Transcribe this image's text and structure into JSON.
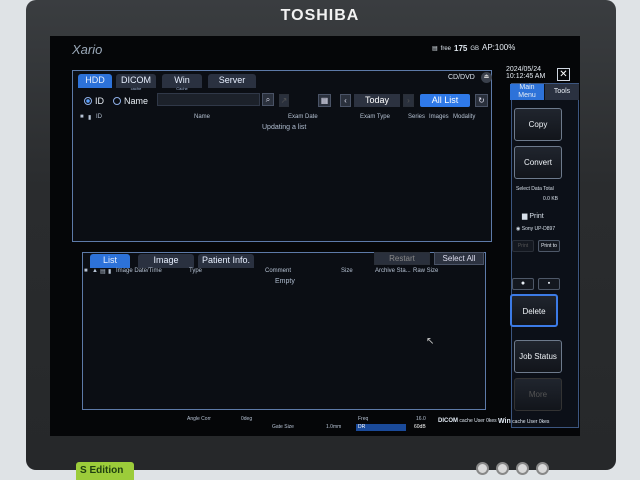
{
  "monitor": {
    "brand": "TOSHIBA",
    "edition": "S Edition"
  },
  "header": {
    "logo": "Xario",
    "free_label": "free",
    "free_value": "175",
    "free_unit": "GB",
    "ap": "AP:100%"
  },
  "upper": {
    "tabs": [
      {
        "label": "HDD",
        "sub": ""
      },
      {
        "label": "DICOM",
        "sub": "cache"
      },
      {
        "label": "Win",
        "sub": "Cache"
      },
      {
        "label": "Server",
        "sub": ""
      }
    ],
    "cd_dvd": "CD/DVD",
    "radio_id": "ID",
    "radio_name": "Name",
    "search_value": "",
    "today": "Today",
    "all_list": "All List",
    "columns": [
      "ID",
      "Name",
      "Exam Date",
      "Exam Type",
      "Series",
      "Images",
      "Modality"
    ],
    "message": "Updating a list"
  },
  "lower": {
    "tabs": [
      "List",
      "Image",
      "Patient Info."
    ],
    "restart": "Restart",
    "select_all": "Select All",
    "columns": [
      "Image Date/Time",
      "Type",
      "Comment",
      "Size",
      "Archive Sta...",
      "Raw Size"
    ],
    "message": "Empty"
  },
  "side": {
    "date": "2024/05/24",
    "time": "10:12:45 AM",
    "tabs": [
      "Main Menu",
      "Tools"
    ],
    "copy": "Copy",
    "convert": "Convert",
    "select_total_label": "Select Data Total",
    "select_total_value": "0.0 KB",
    "print": "Print",
    "printer": "Sony UP-D897",
    "print_btn": "Print",
    "print_to": "Print to",
    "delete": "Delete",
    "job_status": "Job Status",
    "more": "More"
  },
  "status": {
    "angle_corr": "Angle Corr",
    "angle_val": "0deg",
    "gate_size": "Gate Size",
    "gate_val": "1.0mm",
    "freq": "Freq",
    "freq_val": "16.0",
    "dr": "DR",
    "dr_val": "60dB",
    "dicom": "DICOM",
    "dicom_sub": "cache",
    "dicom_user": "User",
    "dicom_stat": "0kes",
    "win": "Win",
    "win_sub": "cache",
    "win_user": "User",
    "win_stat": "0kes"
  }
}
